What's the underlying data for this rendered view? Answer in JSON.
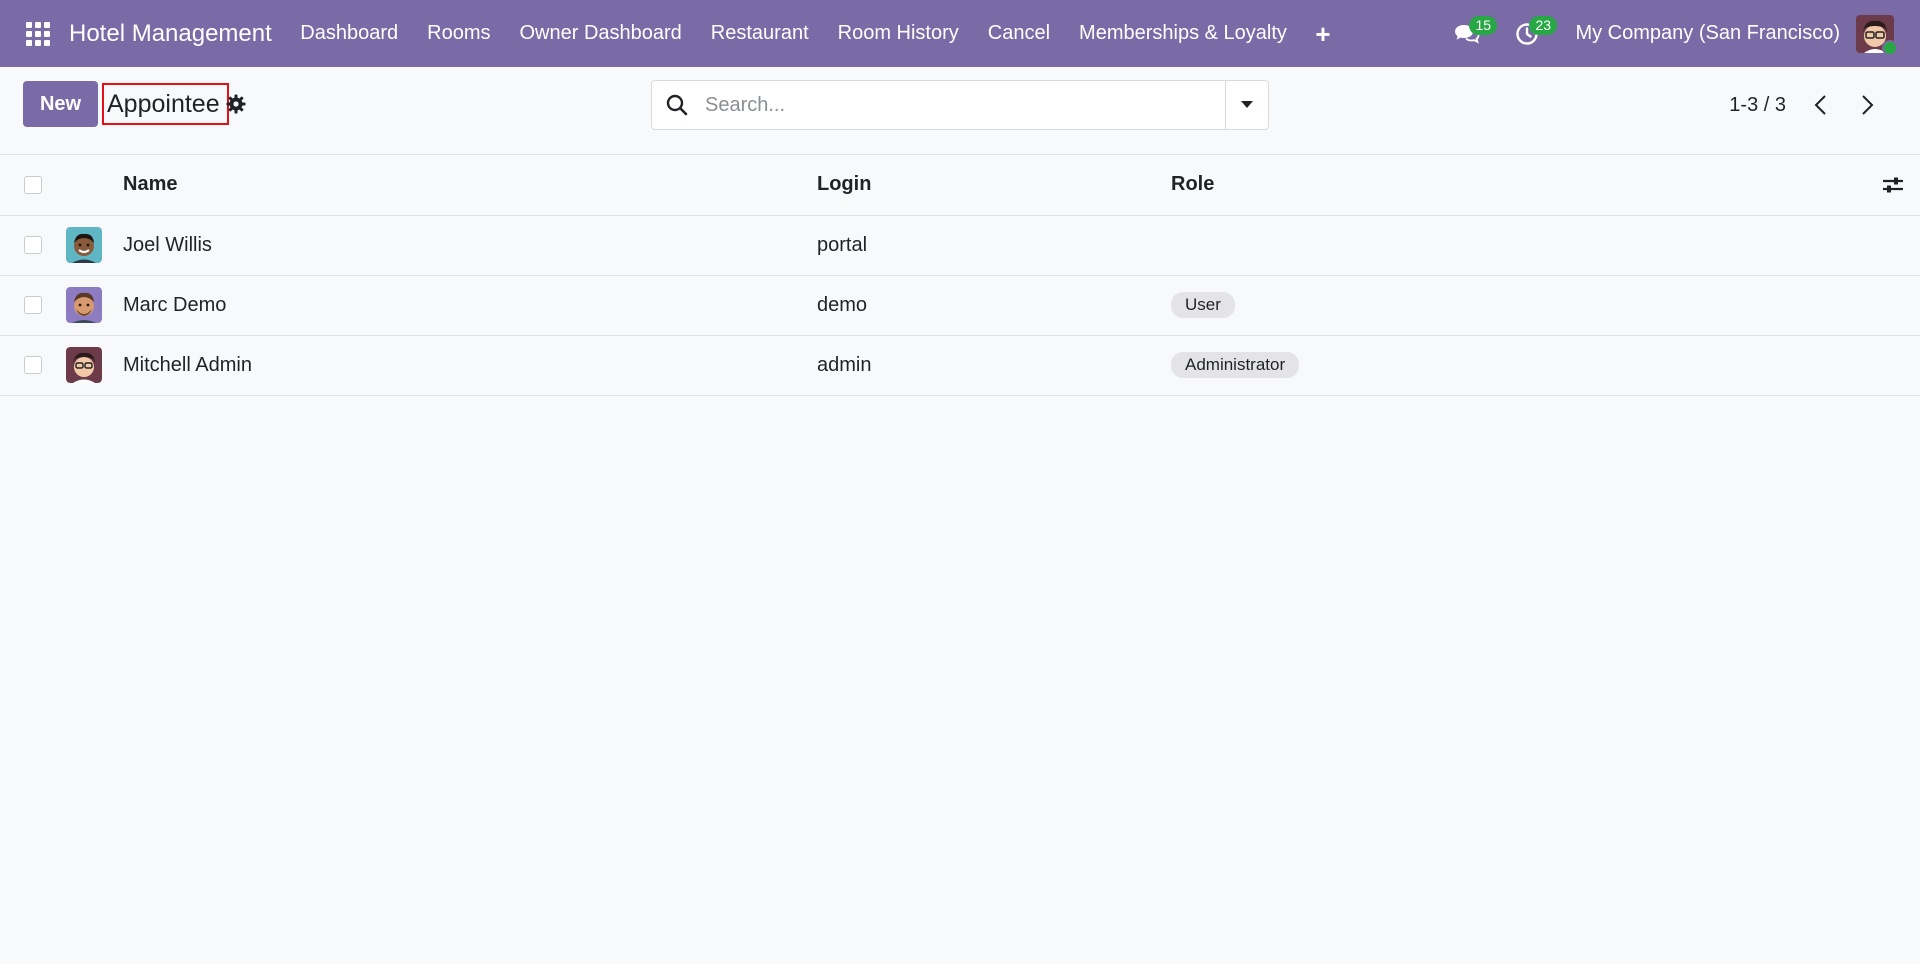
{
  "navbar": {
    "brand": "Hotel Management",
    "menu": [
      {
        "label": "Dashboard"
      },
      {
        "label": "Rooms"
      },
      {
        "label": "Owner Dashboard"
      },
      {
        "label": "Restaurant"
      },
      {
        "label": "Room History"
      },
      {
        "label": "Cancel"
      },
      {
        "label": "Memberships & Loyalty"
      }
    ],
    "messages_count": "15",
    "activities_count": "23",
    "company": "My Company (San Francisco)",
    "colors": {
      "bar": "#7a6aa6",
      "badge": "#28a745"
    }
  },
  "control_panel": {
    "new_label": "New",
    "title": "Appointee",
    "search_placeholder": "Search...",
    "pager": "1-3 / 3"
  },
  "table": {
    "columns": {
      "name": "Name",
      "login": "Login",
      "role": "Role"
    },
    "rows": [
      {
        "name": "Joel Willis",
        "login": "portal",
        "role": ""
      },
      {
        "name": "Marc Demo",
        "login": "demo",
        "role": "User"
      },
      {
        "name": "Mitchell Admin",
        "login": "admin",
        "role": "Administrator"
      }
    ]
  }
}
